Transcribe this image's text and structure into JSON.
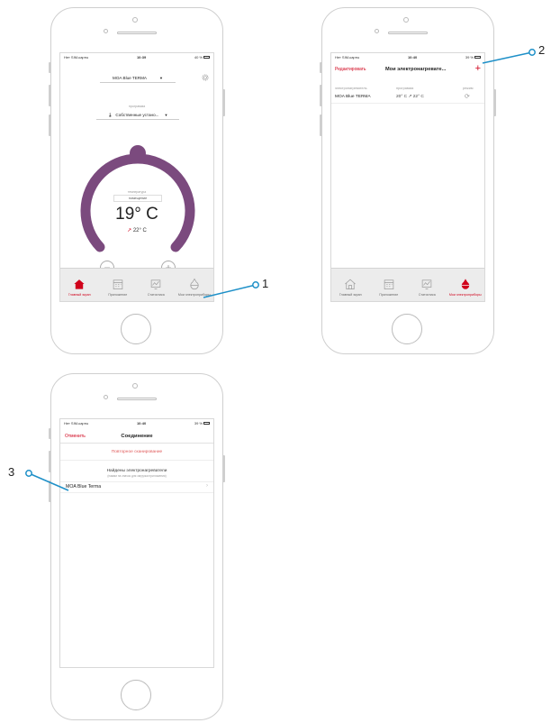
{
  "callouts": [
    "1",
    "2",
    "3"
  ],
  "colors": {
    "accent": "#d0021b",
    "dial": "#7b4a7e",
    "callout": "#1e90c8"
  },
  "status": {
    "carrier": "Нет SIM-карты",
    "time1": "10:39",
    "time2": "10:40",
    "time3": "10:40",
    "battery1": "40 %",
    "battery2": "39 %",
    "battery3": "39 %"
  },
  "tabs": [
    {
      "label": "Главный экран",
      "icon": "house-icon"
    },
    {
      "label": "Приложение",
      "icon": "calendar-icon"
    },
    {
      "label": "Статистика",
      "icon": "chart-icon"
    },
    {
      "label": "Мои электроприборы",
      "icon": "boiler-icon"
    }
  ],
  "screen1": {
    "device": "MOA Blue TERMA",
    "program_label": "программа",
    "program": "Собственные устано...",
    "temp_label": "температура",
    "temp_box": "помещение",
    "current_temp": "19° C",
    "set_temp": "22° C"
  },
  "screen2": {
    "edit": "Редактировать",
    "title": "Мои электронагревате...",
    "col_heater": "электронагреватель",
    "col_program": "программа",
    "col_mode": "режим",
    "device": "MOA Blue TERMA",
    "temps": "20° C ↗ 22° C"
  },
  "screen3": {
    "cancel": "Отменить",
    "title": "Соединение",
    "rescan": "Повторное сканирование",
    "found": "Найдены электронагреватели",
    "found_sub": "(нажми на значок для загрузки приложения)",
    "device": "MOA Blue Terma"
  }
}
